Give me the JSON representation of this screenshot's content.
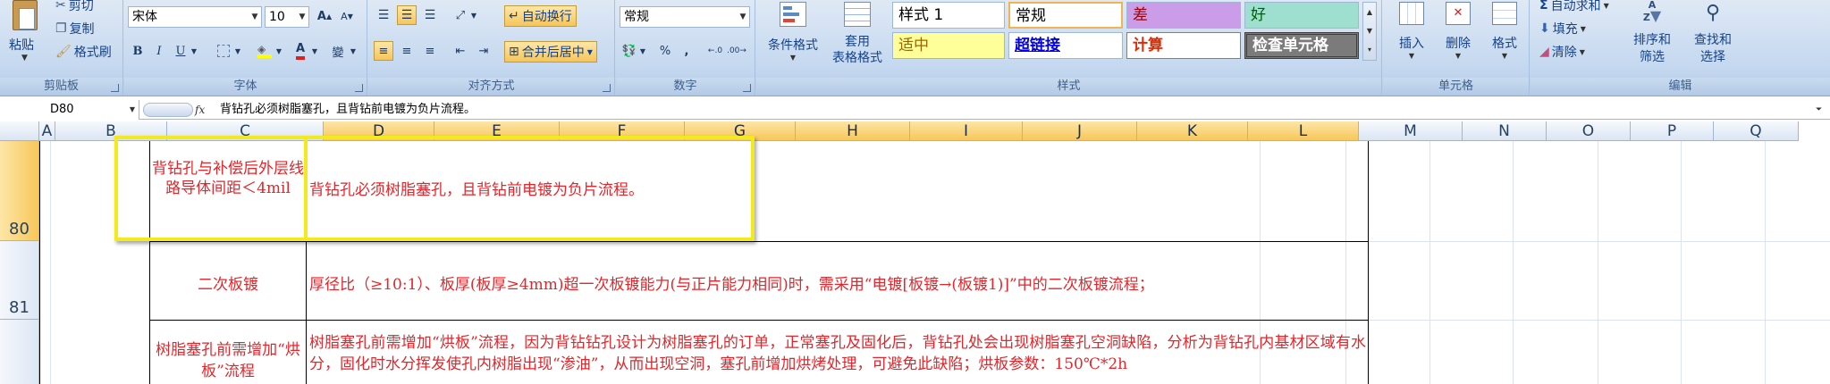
{
  "clipboard": {
    "paste": "粘贴",
    "cut": "剪切",
    "copy": "复制",
    "format_painter": "格式刷",
    "label": "剪贴板"
  },
  "font": {
    "name": "宋体",
    "size": "10",
    "grow": "A",
    "shrink": "A",
    "bold": "B",
    "italic": "I",
    "underline": "U",
    "font_color_letter": "A",
    "phonetic": "變",
    "label": "字体"
  },
  "alignment": {
    "wrap_text": "自动换行",
    "merge_center": "合并后居中",
    "label": "对齐方式"
  },
  "number": {
    "format": "常规",
    "percent": "%",
    "comma": ",",
    "label": "数字"
  },
  "styles": {
    "conditional_format": "条件格式",
    "format_as_table": "套用\n表格格式",
    "cells": [
      {
        "text": "样式 1"
      },
      {
        "text": "常规"
      },
      {
        "text": "差"
      },
      {
        "text": "好"
      },
      {
        "text": "适中"
      },
      {
        "text": "超链接"
      },
      {
        "text": "计算"
      },
      {
        "text": "检查单元格"
      }
    ],
    "label": "样式"
  },
  "cells_group": {
    "insert": "插入",
    "delete": "删除",
    "format": "格式",
    "label": "单元格"
  },
  "editing": {
    "autosum": "自动求和",
    "fill": "填充",
    "clear": "清除",
    "sort_filter": "排序和\n筛选",
    "find_select": "查找和\n选择",
    "label": "编辑"
  },
  "formula_bar": {
    "name_box": "D80",
    "fx": "fx",
    "content": "背钻孔必须树脂塞孔，且背钻前电镀为负片流程。"
  },
  "columns": [
    {
      "label": "A"
    },
    {
      "label": "B"
    },
    {
      "label": "C"
    },
    {
      "label": "D"
    },
    {
      "label": "E"
    },
    {
      "label": "F"
    },
    {
      "label": "G"
    },
    {
      "label": "H"
    },
    {
      "label": "I"
    },
    {
      "label": "J"
    },
    {
      "label": "K"
    },
    {
      "label": "L"
    },
    {
      "label": "M"
    },
    {
      "label": "N"
    },
    {
      "label": "O"
    },
    {
      "label": "P"
    },
    {
      "label": "Q"
    }
  ],
  "rows": [
    {
      "number": "80",
      "title": "背钻孔与补偿后外层线路导体间距＜4mil",
      "content": "背钻孔必须树脂塞孔，且背钻前电镀为负片流程。"
    },
    {
      "number": "81",
      "title": "二次板镀",
      "content": "厚径比（≥10:1）、板厚(板厚≥4mm)超一次板镀能力(与正片能力相同)时，需采用“电镀[板镀→(板镀1)]”中的二次板镀流程；"
    },
    {
      "number": "",
      "title": "树脂塞孔前需增加“烘板”流程",
      "content": "树脂塞孔前需增加“烘板”流程，因为背钻钻孔设计为树脂塞孔的订单，正常塞孔及固化后，背钻孔处会出现树脂塞孔空洞缺陷，分析为背钻孔内基材区域有水分，固化时水分挥发使孔内树脂出现“渗油”，从而出现空洞，塞孔前增加烘烤处理，可避免此缺陷；烘板参数：150℃*2h"
    }
  ]
}
